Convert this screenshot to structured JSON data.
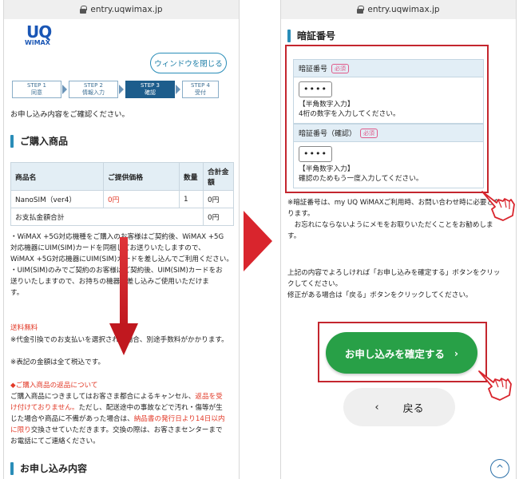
{
  "left_phone": {
    "url": "entry.uqwimax.jp",
    "logo": {
      "uq": "UQ",
      "wimax": "WiMAX"
    },
    "close_button": "ウィンドウを閉じる",
    "steps": [
      {
        "num": "STEP 1",
        "label": "同意"
      },
      {
        "num": "STEP 2",
        "label": "情報入力"
      },
      {
        "num": "STEP 3",
        "label": "確認"
      },
      {
        "num": "STEP 4",
        "label": "受付"
      }
    ],
    "intro": "お申し込み内容をご確認ください。",
    "purchase_heading": "ご購入商品",
    "table": {
      "headers": [
        "商品名",
        "ご提供価格",
        "数量",
        "合計金額"
      ],
      "row": {
        "name": "NanoSIM（ver4）",
        "price": "0円",
        "qty": "1",
        "total": "0円"
      },
      "sum_label": "お支払金額合計",
      "sum_value": "0円"
    },
    "note_1_lines": [
      "・WiMAX +5G対応機種をご購入のお客様はご契約後、WiMAX +5G",
      "対応機器にUIM(SIM)カードを同梱してお送りいたしますので、",
      "WiMAX +5G対応機器にUIM(SIM)カードを差し込んでご利用ください。"
    ],
    "note_2_lines": [
      "・UIM(SIM)のみでご契約のお客様はご契約後、UIM(SIM)カードをお",
      "送りいたしますので、お持ちの機器に差し込みご使用いただけま",
      "す。"
    ],
    "shipping_free": "送料無料",
    "cod_note": "※代金引換でのお支払いを選択された場合、別途手数料がかかります。",
    "tax_note": "※表記の金額は全て税込です。",
    "return_heading": "◆ご購入商品の返品について",
    "return_lines": [
      {
        "segments": [
          {
            "t": "ご購入商品につきましてはお客さま都合によるキャンセル、",
            "red": false
          },
          {
            "t": "返品を受",
            "red": true
          }
        ]
      },
      {
        "segments": [
          {
            "t": "け付けておりません。",
            "red": true
          },
          {
            "t": "ただし、配送途中の事故などで汚れ・傷等が生",
            "red": false
          }
        ]
      },
      {
        "segments": [
          {
            "t": "じた場合や商品に不備があった場合は、",
            "red": false
          },
          {
            "t": "納品書の発行日より14日以内",
            "red": true
          }
        ]
      },
      {
        "segments": [
          {
            "t": "に限り",
            "red": true
          },
          {
            "t": "交換させていただきます。交換の際は、お客さまセンターまで",
            "red": false
          }
        ]
      },
      {
        "segments": [
          {
            "t": "お電話にてご連絡ください。",
            "red": false
          }
        ]
      }
    ],
    "application_heading": "お申し込み内容"
  },
  "right_phone": {
    "url": "entry.uqwimax.jp",
    "pin_heading": "暗証番号",
    "pin_fields": [
      {
        "label": "暗証番号",
        "required": "必須",
        "value": "••••",
        "note1": "【半角数字入力】",
        "note2": "4桁の数字を入力してください。"
      },
      {
        "label": "暗証番号（確認）",
        "required": "必須",
        "value": "••••",
        "note1": "【半角数字入力】",
        "note2": "確認のためもう一度入力してください。"
      }
    ],
    "pin_note_lines": [
      "※暗証番号は、my UQ WiMAXご利用時、お問い合わせ時に必要とな",
      "ります。",
      "　お忘れにならないようにメモをお取りいただくことをお勧めしま",
      "す。"
    ],
    "confirm_instruction_lines": [
      "上記の内容でよろしければ「お申し込みを確定する」ボタンをクリッ",
      "クしてください。",
      "修正がある場合は「戻る」ボタンをクリックしてください。"
    ],
    "confirm_button": "お申し込みを確定する",
    "confirm_chevron": "›",
    "back_chevron": "‹",
    "back_button": "戻る",
    "scroll_top_glyph": "^"
  },
  "colors": {
    "accent_blue": "#2a8db8",
    "step_active": "#1d5d8c",
    "confirm_green": "#28a047",
    "highlight_red": "#c4262e",
    "notice_red": "#e23a28"
  }
}
